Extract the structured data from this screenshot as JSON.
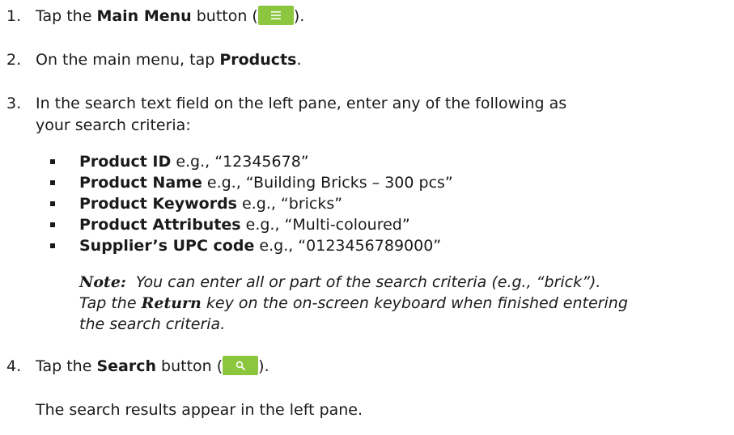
{
  "steps": [
    {
      "number": "1.",
      "before": "Tap the ",
      "bold": "Main Menu",
      "after": " button (",
      "close": ")."
    },
    {
      "number": "2.",
      "before": "On the main menu, tap ",
      "bold": "Products",
      "after": "."
    },
    {
      "number": "3.",
      "line1": "In the search text field on the left pane, enter any of the following as",
      "line2": "your search criteria:"
    },
    {
      "number": "4.",
      "before": "Tap the ",
      "bold": "Search",
      "after": " button (",
      "close": ")."
    }
  ],
  "criteria": [
    {
      "label": "Product ID",
      "example": " e.g., “12345678”"
    },
    {
      "label": "Product Name",
      "example": " e.g., “Building Bricks – 300 pcs”"
    },
    {
      "label": "Product Keywords",
      "example": " e.g., “bricks”"
    },
    {
      "label": "Product Attributes",
      "example": " e.g., “Multi-coloured”"
    },
    {
      "label": "Supplier’s UPC code",
      "example": " e.g., “0123456789000”"
    }
  ],
  "note": {
    "label": "Note:",
    "line1": "You can enter all or part of the search criteria (e.g., “brick”).",
    "line2_before": "Tap the ",
    "line2_key": "Return",
    "line2_after": " key on the on-screen keyboard when finished entering",
    "line3": "the search criteria."
  },
  "result_text": "The search results appear in the left pane.",
  "icons": {
    "main_menu": "menu-icon",
    "search": "search-icon"
  },
  "colors": {
    "button_green": "#8cc63f"
  }
}
